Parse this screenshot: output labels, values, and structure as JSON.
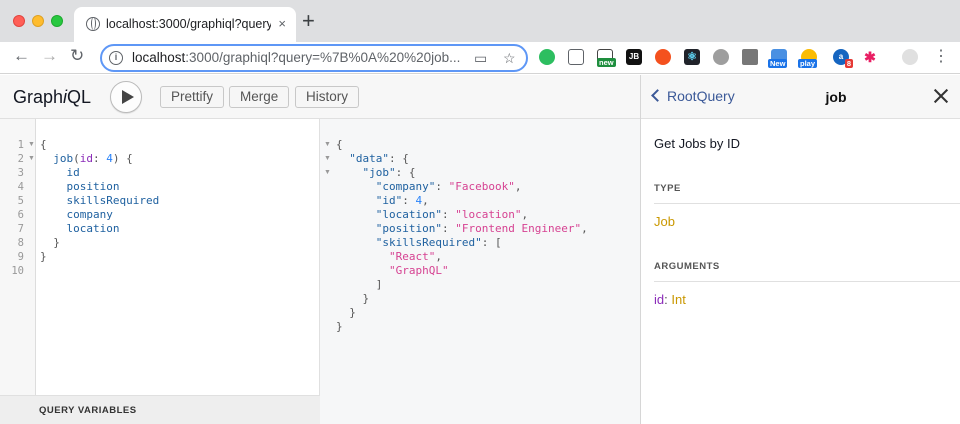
{
  "browser": {
    "tab_title": "localhost:3000/graphiql?query",
    "tab_close": "×",
    "new_tab": "+",
    "url_host": "localhost",
    "url_rest": ":3000/graphiql?query=%7B%0A%20%20job..."
  },
  "graphiql": {
    "logo_prefix": "Graph",
    "logo_i": "i",
    "logo_suffix": "QL",
    "buttons": [
      "Prettify",
      "Merge",
      "History"
    ],
    "query_lines": [
      "{",
      "  job(id: 4) {",
      "    id",
      "    position",
      "    skillsRequired",
      "    company",
      "    location",
      "  }",
      "}",
      ""
    ],
    "query_variables_label": "QUERY VARIABLES",
    "result": {
      "company": "Facebook",
      "id": 4,
      "location": "location",
      "position": "Frontend Engineer",
      "skillsRequired": [
        "React",
        "GraphQL"
      ]
    }
  },
  "docs": {
    "back_label": "RootQuery",
    "title": "job",
    "description": "Get Jobs by ID",
    "type_section": "TYPE",
    "type_value": "Job",
    "arguments_section": "ARGUMENTS",
    "arg_name": "id",
    "arg_type": "Int"
  },
  "colors": {
    "accent_blue": "#3b5998",
    "type_yellow": "#ca9800",
    "arg_purple": "#8b2bb9",
    "string_pink": "#d64292",
    "number_blue": "#2882f9"
  }
}
